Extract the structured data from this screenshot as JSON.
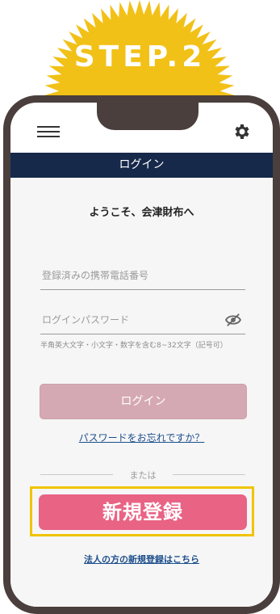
{
  "step_title": "STEP.2",
  "nav": {
    "title": "ログイン"
  },
  "welcome": "ようこそ、会津財布へ",
  "phone_field": {
    "placeholder": "登録済みの携帯電話番号"
  },
  "password_field": {
    "placeholder": "ログインパスワード"
  },
  "password_hint": "半角英大文字・小文字・数字を含む8~32文字（記号可）",
  "login_button": "ログイン",
  "forgot_password": "パスワードをお忘れですか？",
  "divider_text": "または",
  "signup_button": "新規登録",
  "corporate_signup": "法人の方の新規登録はこちら",
  "icons": {
    "menu": "hamburger-icon",
    "settings": "gear-icon",
    "password": "eye-off-icon"
  },
  "colors": {
    "burst": "#f2c117",
    "phone_frame": "#4a3f3c",
    "navbar": "#17294a",
    "login_button": "#d5a9b3",
    "signup_button": "#e96384",
    "highlight": "#f0c400",
    "link": "#1d4f8c"
  }
}
